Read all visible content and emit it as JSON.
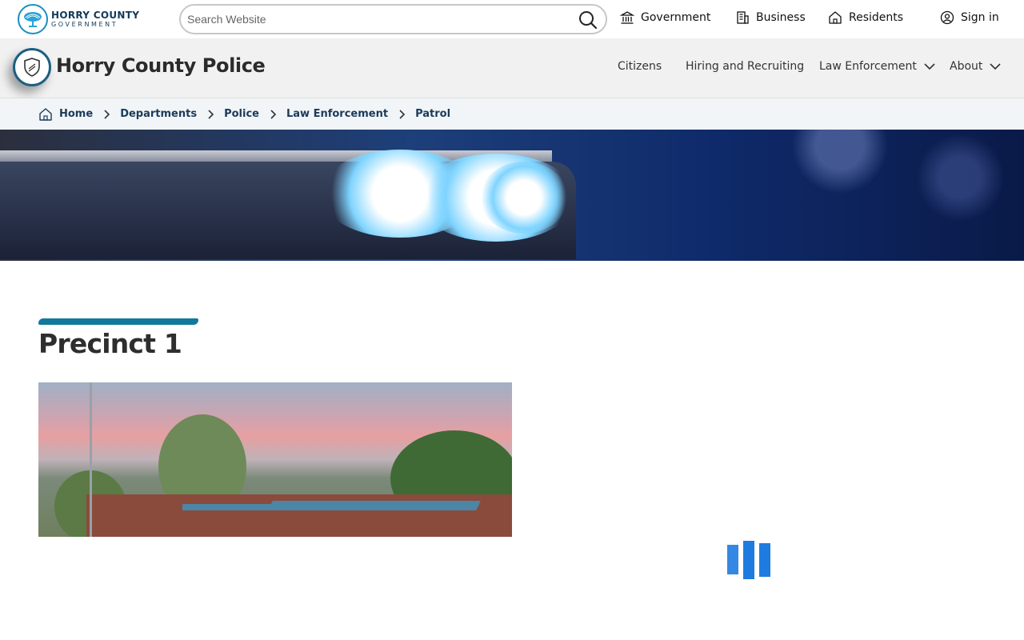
{
  "brand": {
    "name_line1": "HORRY COUNTY",
    "name_line2": "GOVERNMENT"
  },
  "search": {
    "placeholder": "Search Website",
    "value": ""
  },
  "top_nav": {
    "government": "Government",
    "business": "Business",
    "residents": "Residents",
    "sign_in": "Sign in"
  },
  "department": {
    "title": "Horry County Police"
  },
  "main_nav": {
    "citizens": "Citizens",
    "hiring": "Hiring and Recruiting",
    "law_enforcement": "Law Enforcement",
    "about": "About"
  },
  "breadcrumb": {
    "items": [
      "Home",
      "Departments",
      "Police",
      "Law Enforcement",
      "Patrol"
    ]
  },
  "page": {
    "title": "Precinct 1"
  },
  "colors": {
    "accent": "#12789c",
    "brand_dark": "#1b3a5a",
    "loader": "#1e7be0"
  }
}
